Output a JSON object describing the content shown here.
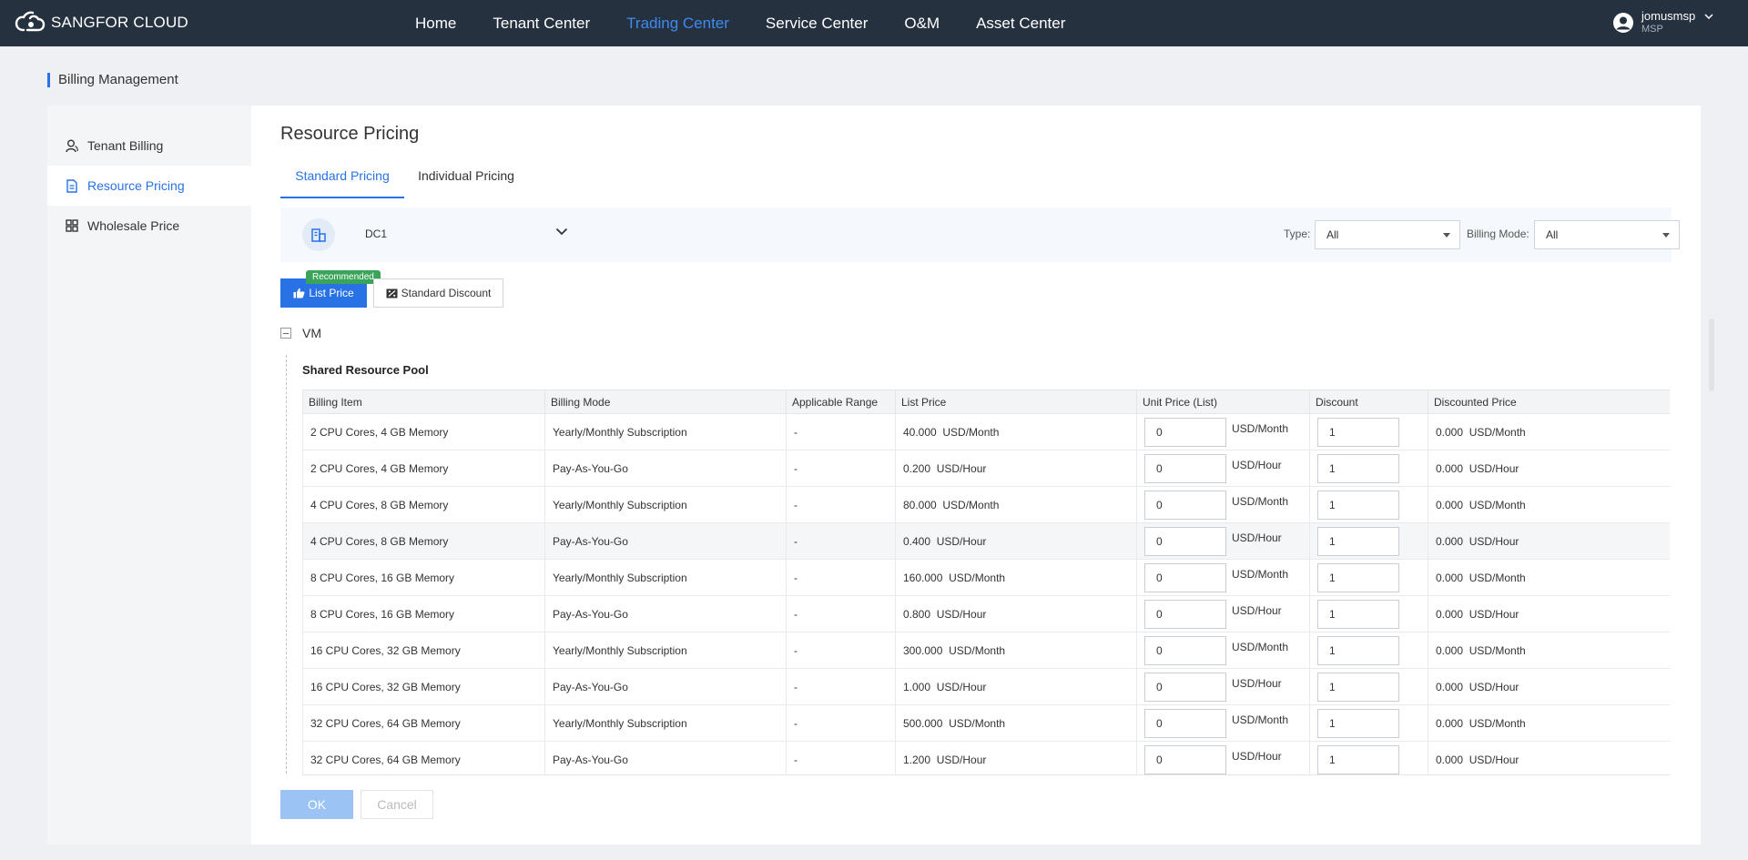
{
  "app": {
    "logo_text": "SANGFOR CLOUD",
    "nav": [
      "Home",
      "Tenant Center",
      "Trading Center",
      "Service Center",
      "O&M",
      "Asset Center"
    ],
    "active_nav": "Trading Center",
    "user": {
      "name": "jomusmsp",
      "role": "MSP"
    }
  },
  "page": {
    "title": "Billing Management"
  },
  "sidebar": {
    "items": [
      {
        "label": "Tenant Billing",
        "icon": "user-icon"
      },
      {
        "label": "Resource Pricing",
        "icon": "document-icon"
      },
      {
        "label": "Wholesale Price",
        "icon": "grid-icon"
      }
    ],
    "active": "Resource Pricing"
  },
  "main": {
    "title": "Resource Pricing",
    "tabs": [
      "Standard Pricing",
      "Individual Pricing"
    ],
    "active_tab": "Standard Pricing",
    "datacenter": "DC1",
    "filters": {
      "type_label": "Type:",
      "type_value": "All",
      "billing_mode_label": "Billing Mode:",
      "billing_mode_value": "All"
    },
    "buttons": {
      "list_price": "List Price",
      "recommended_badge": "Recommended",
      "standard_discount": "Standard Discount",
      "ok": "OK",
      "cancel": "Cancel"
    },
    "group_label": "VM",
    "pool_title": "Shared Resource Pool",
    "table": {
      "headers": [
        "Billing Item",
        "Billing Mode",
        "Applicable Range",
        "List Price",
        "Unit Price (List)",
        "Discount",
        "Discounted Price"
      ],
      "rows": [
        {
          "item": "2 CPU Cores, 4 GB Memory",
          "mode": "Yearly/Monthly Subscription",
          "range": "-",
          "list_price": "40.000",
          "list_unit": "USD/Month",
          "unit_price": "0",
          "unit_price_unit": "USD/Month",
          "discount": "1",
          "discounted": "0.000",
          "discounted_unit": "USD/Month"
        },
        {
          "item": "2 CPU Cores, 4 GB Memory",
          "mode": "Pay-As-You-Go",
          "range": "-",
          "list_price": "0.200",
          "list_unit": "USD/Hour",
          "unit_price": "0",
          "unit_price_unit": "USD/Hour",
          "discount": "1",
          "discounted": "0.000",
          "discounted_unit": "USD/Hour"
        },
        {
          "item": "4 CPU Cores, 8 GB Memory",
          "mode": "Yearly/Monthly Subscription",
          "range": "-",
          "list_price": "80.000",
          "list_unit": "USD/Month",
          "unit_price": "0",
          "unit_price_unit": "USD/Month",
          "discount": "1",
          "discounted": "0.000",
          "discounted_unit": "USD/Month"
        },
        {
          "item": "4 CPU Cores, 8 GB Memory",
          "mode": "Pay-As-You-Go",
          "range": "-",
          "list_price": "0.400",
          "list_unit": "USD/Hour",
          "unit_price": "0",
          "unit_price_unit": "USD/Hour",
          "discount": "1",
          "discounted": "0.000",
          "discounted_unit": "USD/Hour"
        },
        {
          "item": "8 CPU Cores, 16 GB Memory",
          "mode": "Yearly/Monthly Subscription",
          "range": "-",
          "list_price": "160.000",
          "list_unit": "USD/Month",
          "unit_price": "0",
          "unit_price_unit": "USD/Month",
          "discount": "1",
          "discounted": "0.000",
          "discounted_unit": "USD/Month"
        },
        {
          "item": "8 CPU Cores, 16 GB Memory",
          "mode": "Pay-As-You-Go",
          "range": "-",
          "list_price": "0.800",
          "list_unit": "USD/Hour",
          "unit_price": "0",
          "unit_price_unit": "USD/Hour",
          "discount": "1",
          "discounted": "0.000",
          "discounted_unit": "USD/Hour"
        },
        {
          "item": "16 CPU Cores, 32 GB Memory",
          "mode": "Yearly/Monthly Subscription",
          "range": "-",
          "list_price": "300.000",
          "list_unit": "USD/Month",
          "unit_price": "0",
          "unit_price_unit": "USD/Month",
          "discount": "1",
          "discounted": "0.000",
          "discounted_unit": "USD/Month"
        },
        {
          "item": "16 CPU Cores, 32 GB Memory",
          "mode": "Pay-As-You-Go",
          "range": "-",
          "list_price": "1.000",
          "list_unit": "USD/Hour",
          "unit_price": "0",
          "unit_price_unit": "USD/Hour",
          "discount": "1",
          "discounted": "0.000",
          "discounted_unit": "USD/Hour"
        },
        {
          "item": "32 CPU Cores, 64 GB Memory",
          "mode": "Yearly/Monthly Subscription",
          "range": "-",
          "list_price": "500.000",
          "list_unit": "USD/Month",
          "unit_price": "0",
          "unit_price_unit": "USD/Month",
          "discount": "1",
          "discounted": "0.000",
          "discounted_unit": "USD/Month"
        },
        {
          "item": "32 CPU Cores, 64 GB Memory",
          "mode": "Pay-As-You-Go",
          "range": "-",
          "list_price": "1.200",
          "list_unit": "USD/Hour",
          "unit_price": "0",
          "unit_price_unit": "USD/Hour",
          "discount": "1",
          "discounted": "0.000",
          "discounted_unit": "USD/Hour"
        }
      ],
      "highlighted_row": 3
    }
  },
  "colors": {
    "accent": "#2872e6",
    "topbar": "#263140",
    "badge": "#3aa55a"
  }
}
